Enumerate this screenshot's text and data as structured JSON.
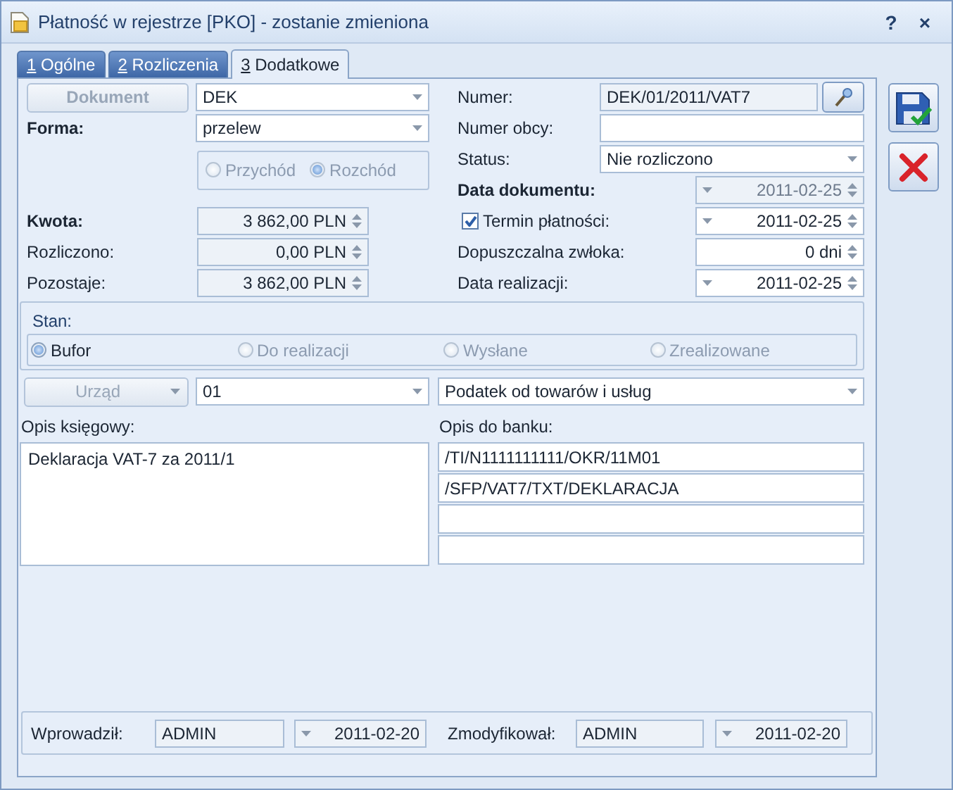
{
  "window": {
    "title": "Płatność w rejestrze [PKO] - zostanie zmieniona",
    "help_button": "?",
    "close_button": "×"
  },
  "tabs": [
    {
      "key": "1",
      "label": "Ogólne",
      "selected": false
    },
    {
      "key": "2",
      "label": "Rozliczenia",
      "selected": false
    },
    {
      "key": "3",
      "label": "Dodatkowe",
      "selected": true
    }
  ],
  "document": {
    "button": "Dokument",
    "value": "DEK"
  },
  "forma": {
    "label": "Forma:",
    "value": "przelew"
  },
  "direction": [
    {
      "label": "Przychód",
      "selected": false,
      "disabled": true
    },
    {
      "label": "Rozchód",
      "selected": true,
      "disabled": true
    }
  ],
  "amounts": [
    {
      "label": "Kwota:",
      "value": "3 862,00 PLN",
      "bold": true
    },
    {
      "label": "Rozliczono:",
      "value": "0,00 PLN",
      "bold": false
    },
    {
      "label": "Pozostaje:",
      "value": "3 862,00 PLN",
      "bold": false
    }
  ],
  "numer": {
    "label": "Numer:",
    "value": "DEK/01/2011/VAT7"
  },
  "numer_obcy": {
    "label": "Numer obcy:"
  },
  "status": {
    "label": "Status:",
    "value": "Nie rozliczono"
  },
  "dates": [
    {
      "kind": "date",
      "label": "Data dokumentu:",
      "value": "2011-02-25",
      "bold": true,
      "disabled": true
    },
    {
      "kind": "checkbox",
      "label": "Termin płatności:",
      "value": "2011-02-25",
      "checked": true,
      "bold": false,
      "disabled": false
    },
    {
      "kind": "number",
      "label": "Dopuszczalna zwłoka:",
      "value": "0 dni",
      "bold": false,
      "disabled": false
    },
    {
      "kind": "date",
      "label": "Data realizacji:",
      "value": "2011-02-25",
      "bold": false,
      "disabled": false
    }
  ],
  "stan": {
    "title": "Stan:",
    "options": [
      {
        "label": "Bufor",
        "selected": true,
        "disabled": false
      },
      {
        "label": "Do realizacji",
        "selected": false,
        "disabled": true
      },
      {
        "label": "Wysłane",
        "selected": false,
        "disabled": true
      },
      {
        "label": "Zrealizowane",
        "selected": false,
        "disabled": true
      }
    ]
  },
  "urzad": {
    "button": "Urząd",
    "disabled": true,
    "code": "01",
    "tax": "Podatek od towarów i usług"
  },
  "opis_ksiegowy": {
    "label": "Opis księgowy:",
    "text": "Deklaracja VAT-7 za 2011/1"
  },
  "opis_do_banku": {
    "label": "Opis do banku:",
    "lines": [
      "/TI/N1111111111/OKR/11M01",
      "/SFP/VAT7/TXT/DEKLARACJA"
    ]
  },
  "footer": {
    "created_label": "Wprowadził:",
    "created_by": "ADMIN",
    "created_date": "2011-02-20",
    "modified_label": "Zmodyfikował:",
    "modified_by": "ADMIN",
    "modified_date": "2011-02-20"
  }
}
